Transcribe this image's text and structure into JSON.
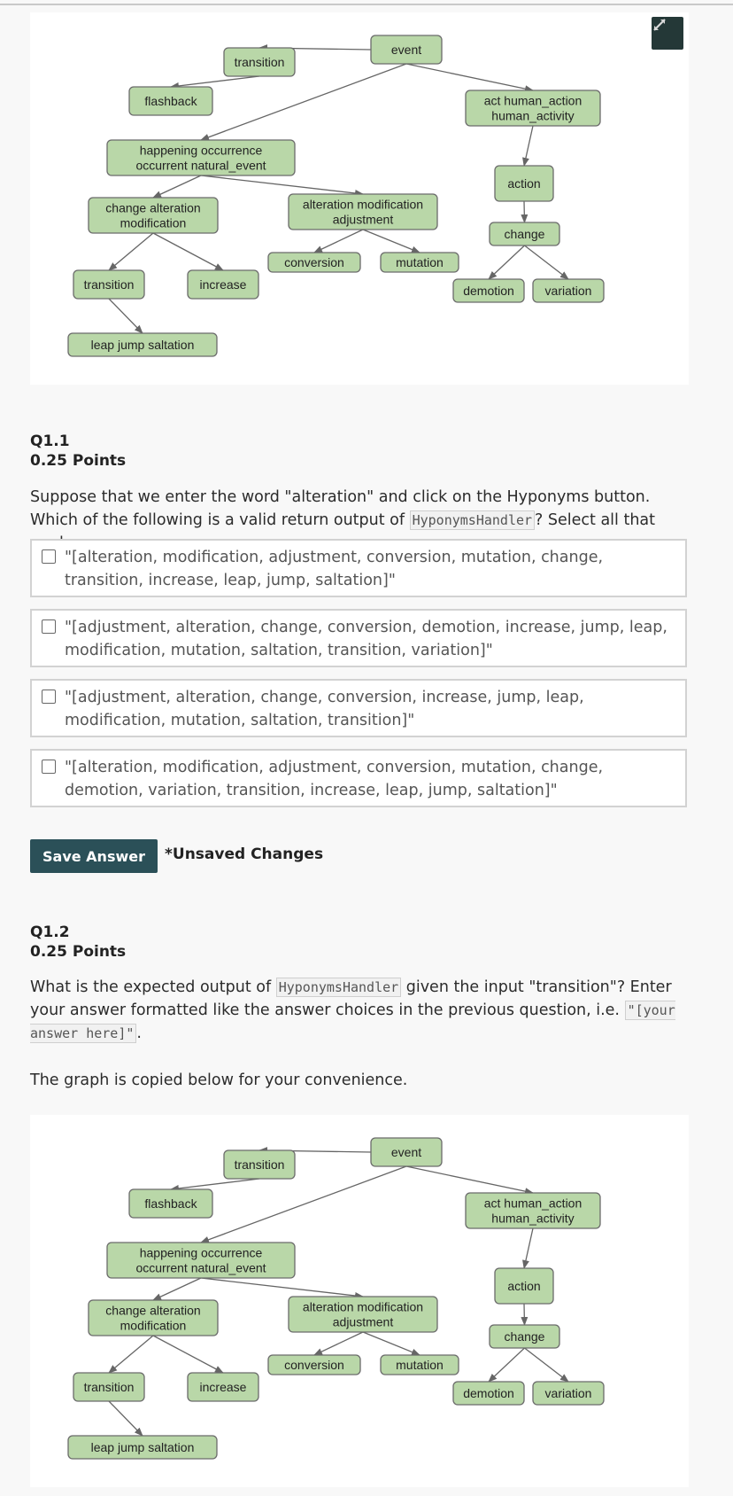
{
  "expand_button": {
    "icon": "expand-arrows-icon"
  },
  "graph": {
    "nodes": [
      {
        "id": "event",
        "label": [
          "event"
        ]
      },
      {
        "id": "transition_top",
        "label": [
          "transition"
        ]
      },
      {
        "id": "flashback",
        "label": [
          "flashback"
        ]
      },
      {
        "id": "act",
        "label": [
          "act human_action",
          "human_activity"
        ]
      },
      {
        "id": "happening",
        "label": [
          "happening occurrence",
          "occurrent natural_event"
        ]
      },
      {
        "id": "action",
        "label": [
          "action"
        ]
      },
      {
        "id": "change_alt",
        "label": [
          "change alteration",
          "modification"
        ]
      },
      {
        "id": "alt_mod",
        "label": [
          "alteration modification",
          "adjustment"
        ]
      },
      {
        "id": "change",
        "label": [
          "change"
        ]
      },
      {
        "id": "conversion",
        "label": [
          "conversion"
        ]
      },
      {
        "id": "mutation",
        "label": [
          "mutation"
        ]
      },
      {
        "id": "transition",
        "label": [
          "transition"
        ]
      },
      {
        "id": "increase",
        "label": [
          "increase"
        ]
      },
      {
        "id": "demotion",
        "label": [
          "demotion"
        ]
      },
      {
        "id": "variation",
        "label": [
          "variation"
        ]
      },
      {
        "id": "leap",
        "label": [
          "leap jump saltation"
        ]
      }
    ],
    "edges": [
      [
        "event",
        "transition_top"
      ],
      [
        "transition_top",
        "flashback"
      ],
      [
        "event",
        "happening"
      ],
      [
        "event",
        "act"
      ],
      [
        "act",
        "action"
      ],
      [
        "action",
        "change"
      ],
      [
        "happening",
        "change_alt"
      ],
      [
        "happening",
        "alt_mod"
      ],
      [
        "change_alt",
        "transition"
      ],
      [
        "change_alt",
        "increase"
      ],
      [
        "alt_mod",
        "conversion"
      ],
      [
        "alt_mod",
        "mutation"
      ],
      [
        "change",
        "demotion"
      ],
      [
        "change",
        "variation"
      ],
      [
        "transition",
        "leap"
      ]
    ]
  },
  "q1": {
    "number": "Q1.1",
    "points": "0.25 Points",
    "text_before": "Suppose that we enter the word \"alteration\" and click on the Hyponyms button. Which of the following is a valid return output of ",
    "code": "HyponymsHandler",
    "text_after": "? Select all that apply.",
    "options": [
      {
        "label": "\"[alteration, modification, adjustment, conversion, mutation, change, transition, increase, leap, jump, saltation]\"",
        "checked": false
      },
      {
        "label": "\"[adjustment, alteration, change, conversion, demotion, increase, jump, leap, modification, mutation, saltation, transition, variation]\"",
        "checked": false
      },
      {
        "label": "\"[adjustment, alteration, change, conversion, increase, jump, leap, modification, mutation, saltation, transition]\"",
        "checked": false
      },
      {
        "label": "\"[alteration, modification, adjustment, conversion, mutation, change, demotion, variation, transition, increase, leap, jump, saltation]\"",
        "checked": false
      }
    ],
    "save_label": "Save Answer",
    "unsaved_label": "*Unsaved Changes"
  },
  "q2": {
    "number": "Q1.2",
    "points": "0.25 Points",
    "text_before": "What is the expected output of ",
    "code": "HyponymsHandler",
    "text_mid": " given the input \"transition\"? Enter your answer formatted like the answer choices in the previous question, i.e. ",
    "format_code": "\"[your answer here]\"",
    "text_end": ".",
    "note": "The graph is copied below for your convenience."
  }
}
